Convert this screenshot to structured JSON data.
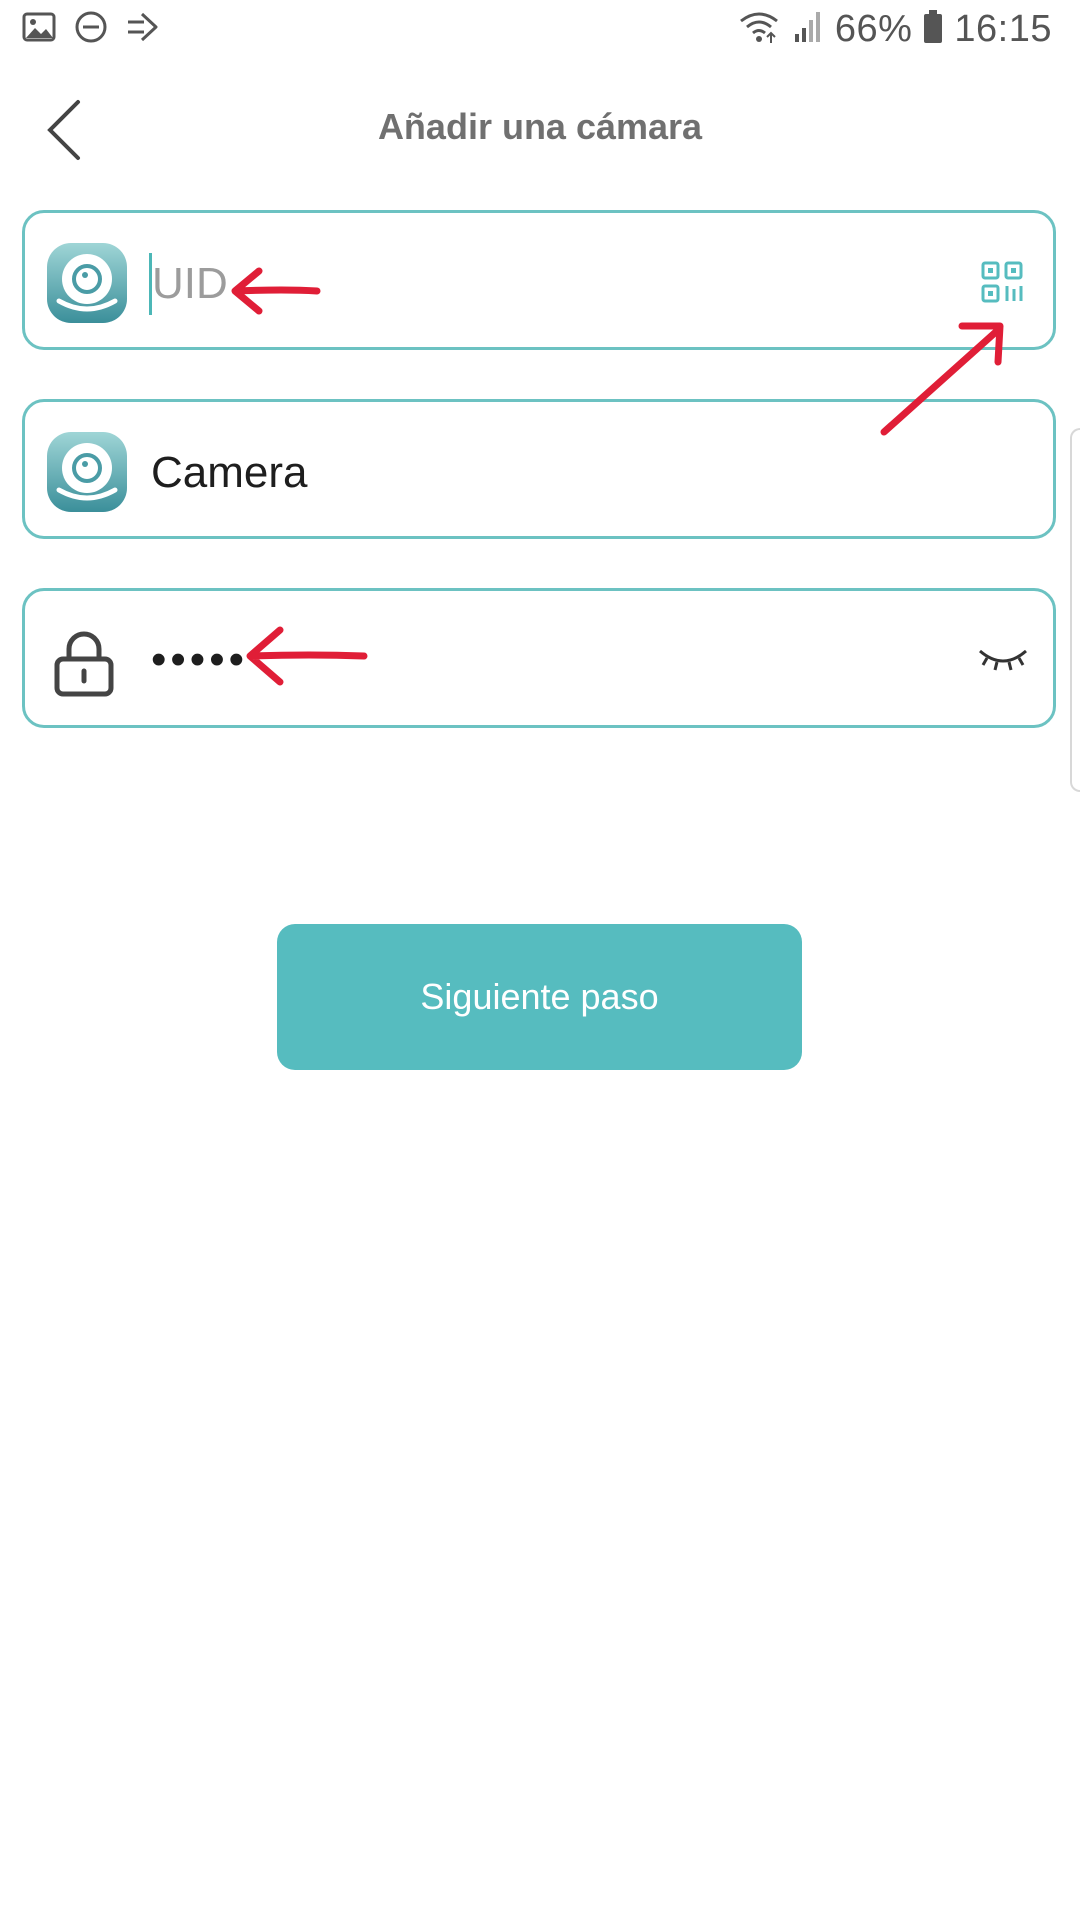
{
  "status_bar": {
    "battery": "66%",
    "time": "16:15",
    "icons": [
      "gallery-icon",
      "dnd-icon",
      "forward-icon",
      "wifi-icon",
      "signal-icon",
      "battery-icon"
    ]
  },
  "header": {
    "title": "Añadir una cámara"
  },
  "form": {
    "uid": {
      "value": "",
      "placeholder": "UID"
    },
    "camera_name": {
      "value": "Camera"
    },
    "password": {
      "value": "•••••"
    }
  },
  "actions": {
    "next_label": "Siguiente paso"
  },
  "colors": {
    "accent": "#56bcbf",
    "field_border": "#6cc2c2",
    "annotation_arrow": "#e01e37"
  }
}
